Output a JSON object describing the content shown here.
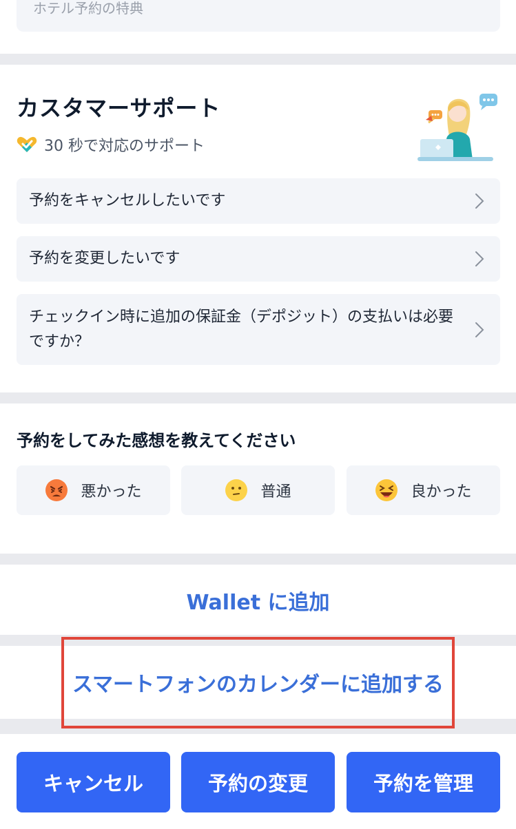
{
  "top_card": {
    "label": "ホテル予約の特典"
  },
  "support": {
    "title": "カスタマーサポート",
    "subtitle": "30 秒で対応のサポート",
    "faqs": [
      {
        "label": "予約をキャンセルしたいです"
      },
      {
        "label": "予約を変更したいです"
      },
      {
        "label": "チェックイン時に追加の保証金（デポジット）の支払いは必要ですか？"
      }
    ]
  },
  "feedback": {
    "title": "予約をしてみた感想を教えてください",
    "options": [
      {
        "label": "悪かった",
        "icon": "angry-face-icon"
      },
      {
        "label": "普通",
        "icon": "neutral-face-icon"
      },
      {
        "label": "良かった",
        "icon": "laughing-face-icon"
      }
    ]
  },
  "wallet_link": "Wallet に追加",
  "calendar_link": "スマートフォンのカレンダーに追加する",
  "actions": {
    "cancel": "キャンセル",
    "change": "予約の変更",
    "manage": "予約を管理"
  },
  "colors": {
    "accent": "#3266f5",
    "link": "#3a6fd8",
    "highlight": "#e0463a"
  }
}
